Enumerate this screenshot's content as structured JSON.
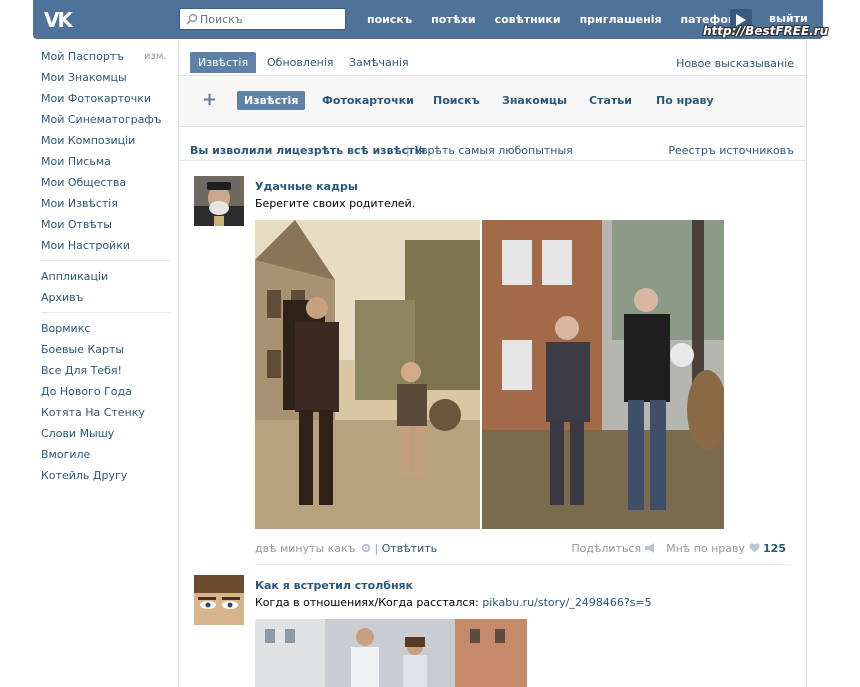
{
  "header": {
    "logo": "VK",
    "search_placeholder": "Поискъ",
    "nav": [
      "поискъ",
      "потѣхи",
      "совѣтники",
      "приглашенія",
      "патефонъ"
    ],
    "logout": "выйти",
    "watermark": "http://BestFREE.ru"
  },
  "sidebar": {
    "edit": "изм.",
    "group1": [
      "Мой Паспортъ",
      "Мои Знакомцы",
      "Мои Фотокарточки",
      "Мой Синематографъ",
      "Мои Композиціи",
      "Мои Письма",
      "Мои Общества",
      "Мои Извѣстія",
      "Мои Отвѣты",
      "Мои Настройки"
    ],
    "group2": [
      "Аппликаціи",
      "Архивъ"
    ],
    "group3": [
      "Вормикс",
      "Боевые Карты",
      "Все Для Тебя!",
      "До Нового Года",
      "Котята На Стенку",
      "Слови Мышу",
      "Вмогиле",
      "Котейль Другу"
    ]
  },
  "tabs": {
    "items": [
      "Извѣстія",
      "Обновленія",
      "Замѣчанія"
    ],
    "right": "Новое высказываніе"
  },
  "filters": {
    "plus": "+",
    "items": [
      "Извѣстія",
      "Фотокарточки",
      "Поискъ",
      "Знакомцы",
      "Статьи",
      "По нраву"
    ]
  },
  "subhead": {
    "bold": "Вы изволили лицезрѣть всѣ извѣстія",
    "separator": "|",
    "link": "Узрѣть самыя любопытныя",
    "right": "Реестръ источниковъ"
  },
  "posts": [
    {
      "author": "Удачные кадры",
      "text": "Берегите своих родителей.",
      "time": "двѣ минуты какъ",
      "reply": "Отвѣтить",
      "share": "Подѣлиться",
      "like": "Мнѣ по нраву",
      "like_count": "125"
    },
    {
      "author": "Как я встретил столбняк",
      "text": "Когда в отношениях/Когда расстался:",
      "link": "pikabu.ru/story/_2498466?s=5"
    }
  ],
  "colors": {
    "header": "#4e729a",
    "link": "#2b587a",
    "accent": "#5e81a8"
  }
}
